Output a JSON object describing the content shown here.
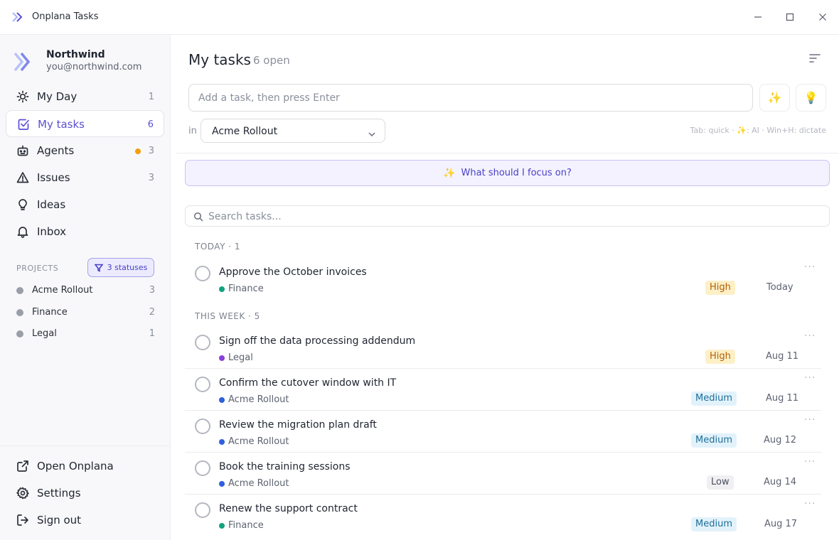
{
  "window": {
    "title": "Onplana Tasks"
  },
  "account": {
    "name": "Northwind",
    "email": "you@northwind.com"
  },
  "nav": [
    {
      "label": "My Day",
      "count": "1",
      "icon": "sun-icon"
    },
    {
      "label": "My tasks",
      "count": "6",
      "icon": "checkbox-icon",
      "active": true
    },
    {
      "label": "Agents",
      "count": "3",
      "icon": "bot-icon",
      "dot_color": "#f59e0b"
    },
    {
      "label": "Issues",
      "count": "3",
      "icon": "warning-icon"
    },
    {
      "label": "Ideas",
      "count": "",
      "icon": "lightbulb-icon"
    },
    {
      "label": "Inbox",
      "count": "",
      "icon": "bell-icon"
    }
  ],
  "projects": {
    "heading": "PROJECTS",
    "filter_label": "3 statuses",
    "items": [
      {
        "name": "Acme Rollout",
        "count": "3"
      },
      {
        "name": "Finance",
        "count": "2"
      },
      {
        "name": "Legal",
        "count": "1"
      }
    ]
  },
  "footer_nav": [
    {
      "label": "Open Onplana",
      "icon": "external-link-icon"
    },
    {
      "label": "Settings",
      "icon": "gear-icon"
    },
    {
      "label": "Sign out",
      "icon": "sign-out-icon"
    }
  ],
  "main": {
    "title": "My tasks",
    "open_count": "6 open",
    "add_placeholder": "Add a task, then press Enter",
    "in_label": "in",
    "project_select": "Acme Rollout",
    "hint": "Tab: quick · ✨: AI · Win+H: dictate",
    "focus_label": "What should I focus on?",
    "search_placeholder": "Search tasks..."
  },
  "groups": [
    {
      "label": "TODAY · 1",
      "tasks": [
        {
          "title": "Approve the October invoices",
          "project": "Finance",
          "project_color": "#10a37f",
          "priority": "High",
          "due": "Today"
        }
      ]
    },
    {
      "label": "THIS WEEK · 5",
      "tasks": [
        {
          "title": "Sign off the data processing addendum",
          "project": "Legal",
          "project_color": "#8b3fd9",
          "priority": "High",
          "due": "Aug 11"
        },
        {
          "title": "Confirm the cutover window with IT",
          "project": "Acme Rollout",
          "project_color": "#2f5fdc",
          "priority": "Medium",
          "due": "Aug 11"
        },
        {
          "title": "Review the migration plan draft",
          "project": "Acme Rollout",
          "project_color": "#2f5fdc",
          "priority": "Medium",
          "due": "Aug 12"
        },
        {
          "title": "Book the training sessions",
          "project": "Acme Rollout",
          "project_color": "#2f5fdc",
          "priority": "Low",
          "due": "Aug 14"
        },
        {
          "title": "Renew the support contract",
          "project": "Finance",
          "project_color": "#10a37f",
          "priority": "Medium",
          "due": "Aug 17"
        }
      ]
    }
  ],
  "colors": {
    "accent": "#5b4fd6",
    "agents_dot": "#f59e0b"
  }
}
